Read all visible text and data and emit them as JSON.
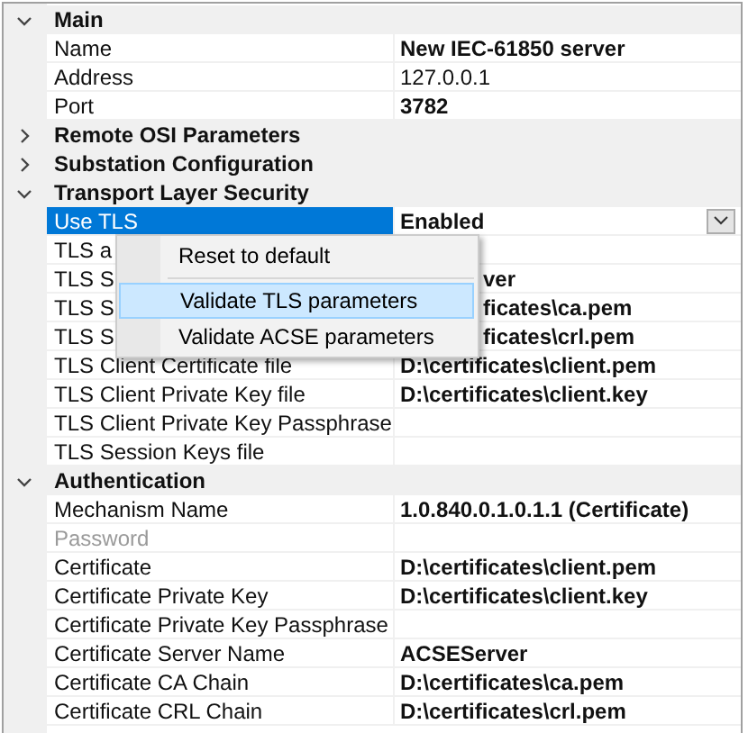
{
  "categories": [
    {
      "title": "Main",
      "expanded": true,
      "rows": [
        {
          "label": "Name",
          "value": "New IEC-61850 server",
          "modified": true,
          "selected": false,
          "disabled": false
        },
        {
          "label": "Address",
          "value": "127.0.0.1",
          "modified": false,
          "selected": false,
          "disabled": false
        },
        {
          "label": "Port",
          "value": "3782",
          "modified": true,
          "selected": false,
          "disabled": false
        }
      ]
    },
    {
      "title": "Remote OSI Parameters",
      "expanded": false
    },
    {
      "title": "Substation Configuration",
      "expanded": false
    },
    {
      "title": "Transport Layer Security",
      "expanded": true,
      "rows": [
        {
          "label": "Use TLS",
          "value": "Enabled",
          "modified": true,
          "selected": true,
          "disabled": false,
          "dropdown": true
        },
        {
          "label": "TLS a",
          "selected": false,
          "disabled": false
        },
        {
          "label": "TLS S",
          "value": "ver",
          "modified": true,
          "selected": false,
          "disabled": false,
          "covered": true
        },
        {
          "label": "TLS S",
          "value": "ficates\\ca.pem",
          "modified": true,
          "selected": false,
          "disabled": false,
          "covered": true
        },
        {
          "label": "TLS S",
          "value": "ficates\\crl.pem",
          "modified": true,
          "selected": false,
          "disabled": false,
          "covered": true
        },
        {
          "label": "TLS Client Certificate file",
          "value": "D:\\certificates\\client.pem",
          "modified": true,
          "selected": false,
          "disabled": false
        },
        {
          "label": "TLS Client Private Key file",
          "value": "D:\\certificates\\client.key",
          "modified": true,
          "selected": false,
          "disabled": false
        },
        {
          "label": "TLS Client Private Key Passphrase",
          "selected": false,
          "disabled": false
        },
        {
          "label": "TLS Session Keys file",
          "selected": false,
          "disabled": false
        }
      ]
    },
    {
      "title": "Authentication",
      "expanded": true,
      "rows": [
        {
          "label": "Mechanism Name",
          "value": "1.0.840.0.1.0.1.1 (Certificate)",
          "modified": true,
          "selected": false,
          "disabled": false
        },
        {
          "label": "Password",
          "selected": false,
          "disabled": true
        },
        {
          "label": "Certificate",
          "value": "D:\\certificates\\client.pem",
          "modified": true,
          "selected": false,
          "disabled": false
        },
        {
          "label": "Certificate Private Key",
          "value": "D:\\certificates\\client.key",
          "modified": true,
          "selected": false,
          "disabled": false
        },
        {
          "label": "Certificate Private Key Passphrase",
          "selected": false,
          "disabled": false
        },
        {
          "label": "Certificate Server Name",
          "value": "ACSEServer",
          "modified": true,
          "selected": false,
          "disabled": false
        },
        {
          "label": "Certificate CA Chain",
          "value": "D:\\certificates\\ca.pem",
          "modified": true,
          "selected": false,
          "disabled": false
        },
        {
          "label": "Certificate CRL Chain",
          "value": "D:\\certificates\\crl.pem",
          "modified": true,
          "selected": false,
          "disabled": false
        }
      ]
    }
  ],
  "context_menu": {
    "items": [
      {
        "label": "Reset to default",
        "selected": false,
        "separator_after": true
      },
      {
        "label": "Validate TLS parameters",
        "selected": true
      },
      {
        "label": "Validate ACSE parameters",
        "selected": false
      }
    ]
  }
}
